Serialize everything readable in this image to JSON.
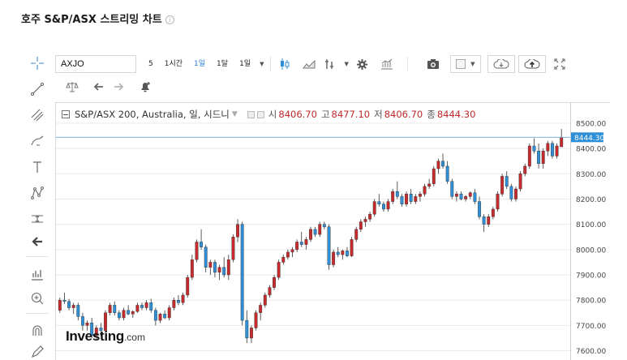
{
  "page_title": "호주 S&P/ASX 스트리밍 차트",
  "colors": {
    "up": "#c62a2d",
    "down": "#2e8fd6",
    "accent": "#2b7fd9",
    "last_price_badge": "#2e8fd6",
    "grid": "#e9e9e9"
  },
  "left_toolbar": {
    "icons": [
      "crosshair-icon",
      "trendline-icon",
      "fib-icon",
      "brush-icon",
      "text-icon",
      "pattern-icon",
      "measure-icon",
      "back-arrow-icon",
      "indicators-icon",
      "zoom-in-icon",
      "magnet-icon",
      "pencil-icon"
    ]
  },
  "toolbar": {
    "symbol": "AXJO",
    "intervals": [
      {
        "label": "5",
        "active": false
      },
      {
        "label": "1시간",
        "active": false
      },
      {
        "label": "1일",
        "active": true
      },
      {
        "label": "1달",
        "active": false
      },
      {
        "label": "1일",
        "active": false
      }
    ],
    "icons_row1": [
      "candle-type-icon",
      "area-chart-icon",
      "compare-icon",
      "settings-icon",
      "indicator-icon",
      "camera-icon",
      "color-square-icon",
      "cloud-load-icon",
      "cloud-save-icon",
      "fullscreen-icon"
    ],
    "icons_row2": [
      "scale-icon",
      "undo-icon",
      "redo-icon",
      "alert-icon"
    ]
  },
  "legend": {
    "symbol_text": "S&P/ASX 200, Australia, 일, 시드니",
    "open_label": "시",
    "open": "8406.70",
    "high_label": "고",
    "high": "8477.10",
    "low_label": "저",
    "low": "8406.70",
    "close_label": "종",
    "close": "8444.30"
  },
  "watermark": {
    "brand": "Investing",
    "suffix": ".com"
  },
  "chart_data": {
    "type": "candlestick",
    "title": "S&P/ASX 200, Australia, 일, 시드니",
    "y_axis": {
      "ylim": [
        7560,
        8580
      ],
      "ticks": [
        8500,
        8400,
        8300,
        8200,
        8100,
        8000,
        7900,
        7800,
        7700,
        7600
      ],
      "tick_labels": [
        "8500.00",
        "8400.00",
        "8300.00",
        "8200.00",
        "8100.00",
        "8000.00",
        "7900.00",
        "7800.00",
        "7700.00",
        "7600.00"
      ],
      "position": "right"
    },
    "last_price": 8444.3,
    "last_price_label": "8444.30",
    "grid": true,
    "candles": [
      [
        7760,
        7810,
        7750,
        7800
      ],
      [
        7800,
        7830,
        7785,
        7795
      ],
      [
        7795,
        7805,
        7760,
        7770
      ],
      [
        7770,
        7790,
        7745,
        7780
      ],
      [
        7780,
        7790,
        7720,
        7735
      ],
      [
        7735,
        7750,
        7680,
        7700
      ],
      [
        7700,
        7720,
        7680,
        7710
      ],
      [
        7710,
        7730,
        7650,
        7660
      ],
      [
        7660,
        7700,
        7640,
        7690
      ],
      [
        7690,
        7710,
        7660,
        7680
      ],
      [
        7680,
        7760,
        7670,
        7750
      ],
      [
        7750,
        7790,
        7740,
        7780
      ],
      [
        7780,
        7795,
        7740,
        7750
      ],
      [
        7750,
        7760,
        7720,
        7730
      ],
      [
        7730,
        7770,
        7720,
        7760
      ],
      [
        7760,
        7780,
        7740,
        7745
      ],
      [
        7745,
        7760,
        7730,
        7755
      ],
      [
        7755,
        7790,
        7750,
        7780
      ],
      [
        7780,
        7790,
        7760,
        7770
      ],
      [
        7770,
        7800,
        7760,
        7790
      ],
      [
        7790,
        7805,
        7750,
        7760
      ],
      [
        7760,
        7770,
        7700,
        7720
      ],
      [
        7720,
        7750,
        7710,
        7745
      ],
      [
        7745,
        7760,
        7725,
        7730
      ],
      [
        7730,
        7780,
        7720,
        7770
      ],
      [
        7770,
        7810,
        7760,
        7800
      ],
      [
        7800,
        7820,
        7780,
        7790
      ],
      [
        7790,
        7830,
        7780,
        7820
      ],
      [
        7820,
        7900,
        7810,
        7890
      ],
      [
        7890,
        7980,
        7880,
        7960
      ],
      [
        7960,
        8040,
        7950,
        8030
      ],
      [
        8030,
        8080,
        8000,
        8010
      ],
      [
        8010,
        8020,
        7910,
        7930
      ],
      [
        7930,
        7960,
        7900,
        7950
      ],
      [
        7950,
        7960,
        7890,
        7910
      ],
      [
        7910,
        7940,
        7880,
        7930
      ],
      [
        7930,
        7970,
        7890,
        7900
      ],
      [
        7900,
        7980,
        7880,
        7960
      ],
      [
        7960,
        8060,
        7950,
        8050
      ],
      [
        8050,
        8120,
        8030,
        8100
      ],
      [
        8100,
        8110,
        7700,
        7720
      ],
      [
        7720,
        7760,
        7630,
        7650
      ],
      [
        7650,
        7700,
        7630,
        7690
      ],
      [
        7690,
        7760,
        7680,
        7750
      ],
      [
        7750,
        7790,
        7720,
        7780
      ],
      [
        7780,
        7830,
        7770,
        7820
      ],
      [
        7820,
        7860,
        7810,
        7850
      ],
      [
        7850,
        7900,
        7840,
        7890
      ],
      [
        7890,
        7960,
        7880,
        7950
      ],
      [
        7950,
        7980,
        7940,
        7970
      ],
      [
        7970,
        8000,
        7960,
        7990
      ],
      [
        7990,
        8010,
        7970,
        8000
      ],
      [
        8000,
        8040,
        7990,
        8030
      ],
      [
        8030,
        8070,
        8010,
        8020
      ],
      [
        8020,
        8050,
        8000,
        8040
      ],
      [
        8040,
        8090,
        8030,
        8080
      ],
      [
        8080,
        8090,
        8050,
        8060
      ],
      [
        8060,
        8110,
        8050,
        8100
      ],
      [
        8100,
        8110,
        8080,
        8090
      ],
      [
        8090,
        8100,
        7920,
        7940
      ],
      [
        7940,
        8000,
        7930,
        7990
      ],
      [
        7990,
        8010,
        7970,
        7980
      ],
      [
        7980,
        8000,
        7960,
        7995
      ],
      [
        7995,
        8010,
        7970,
        7975
      ],
      [
        7975,
        8050,
        7970,
        8040
      ],
      [
        8040,
        8090,
        8030,
        8080
      ],
      [
        8080,
        8120,
        8070,
        8110
      ],
      [
        8110,
        8130,
        8090,
        8120
      ],
      [
        8120,
        8150,
        8110,
        8140
      ],
      [
        8140,
        8200,
        8130,
        8190
      ],
      [
        8190,
        8220,
        8170,
        8180
      ],
      [
        8180,
        8190,
        8150,
        8160
      ],
      [
        8160,
        8200,
        8150,
        8190
      ],
      [
        8190,
        8240,
        8180,
        8230
      ],
      [
        8230,
        8270,
        8200,
        8210
      ],
      [
        8210,
        8220,
        8170,
        8180
      ],
      [
        8180,
        8230,
        8170,
        8220
      ],
      [
        8220,
        8240,
        8180,
        8190
      ],
      [
        8190,
        8220,
        8180,
        8210
      ],
      [
        8210,
        8230,
        8190,
        8220
      ],
      [
        8220,
        8260,
        8210,
        8250
      ],
      [
        8250,
        8280,
        8240,
        8260
      ],
      [
        8260,
        8330,
        8250,
        8320
      ],
      [
        8320,
        8360,
        8300,
        8350
      ],
      [
        8350,
        8380,
        8320,
        8330
      ],
      [
        8330,
        8350,
        8260,
        8270
      ],
      [
        8270,
        8280,
        8200,
        8210
      ],
      [
        8210,
        8230,
        8190,
        8220
      ],
      [
        8220,
        8230,
        8195,
        8200
      ],
      [
        8200,
        8215,
        8190,
        8210
      ],
      [
        8210,
        8230,
        8200,
        8225
      ],
      [
        8225,
        8240,
        8180,
        8190
      ],
      [
        8190,
        8210,
        8120,
        8130
      ],
      [
        8130,
        8140,
        8070,
        8100
      ],
      [
        8100,
        8140,
        8090,
        8130
      ],
      [
        8130,
        8170,
        8120,
        8160
      ],
      [
        8160,
        8230,
        8150,
        8220
      ],
      [
        8220,
        8300,
        8210,
        8290
      ],
      [
        8290,
        8310,
        8240,
        8250
      ],
      [
        8250,
        8260,
        8190,
        8200
      ],
      [
        8200,
        8250,
        8190,
        8240
      ],
      [
        8240,
        8310,
        8230,
        8300
      ],
      [
        8300,
        8340,
        8290,
        8330
      ],
      [
        8330,
        8420,
        8320,
        8410
      ],
      [
        8410,
        8440,
        8380,
        8390
      ],
      [
        8390,
        8420,
        8320,
        8340
      ],
      [
        8340,
        8400,
        8320,
        8390
      ],
      [
        8390,
        8430,
        8370,
        8420
      ],
      [
        8420,
        8430,
        8360,
        8370
      ],
      [
        8370,
        8420,
        8360,
        8410
      ],
      [
        8406.7,
        8477.1,
        8406.7,
        8444.3
      ]
    ]
  }
}
